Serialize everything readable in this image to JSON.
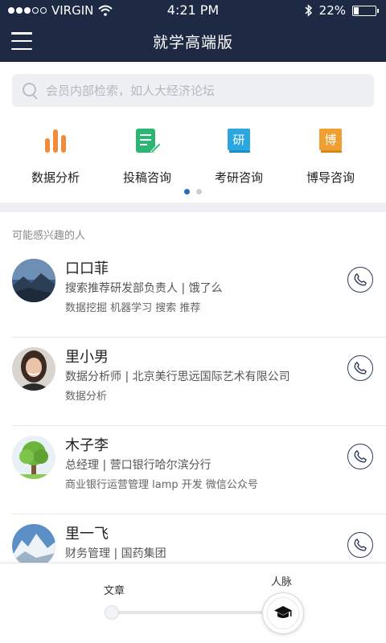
{
  "status_bar": {
    "carrier": "VIRGIN",
    "time": "4:21 PM",
    "battery": "22%",
    "battery_level": 0.22
  },
  "header": {
    "title": "就学高端版"
  },
  "search": {
    "placeholder": "会员内部检索，如人大经济论坛"
  },
  "categories": [
    {
      "label": "数据分析",
      "icon": "bar-chart-icon",
      "color": "#f08a3c"
    },
    {
      "label": "投稿咨询",
      "icon": "document-edit-icon",
      "color": "#2bb673"
    },
    {
      "label": "考研咨询",
      "icon": "book-yan-icon",
      "glyph": "研",
      "color": "#2aa7e0"
    },
    {
      "label": "博导咨询",
      "icon": "book-bo-icon",
      "glyph": "博",
      "color": "#f0a030"
    }
  ],
  "pager": {
    "pages": 2,
    "active": 1
  },
  "people_section": {
    "title": "可能感兴趣的人",
    "people": [
      {
        "name": "口口菲",
        "info": "搜索推荐研发部负责人 | 饿了么",
        "tags": "数据挖掘 机器学习 搜索 推荐"
      },
      {
        "name": "里小男",
        "info": "数据分析师 | 北京美行思远国际艺术有限公司",
        "tags": "数据分析"
      },
      {
        "name": "木子李",
        "info": "总经理  | 营口银行哈尔滨分行",
        "tags": "商业银行运营管理 lamp 开发 微信公众号"
      },
      {
        "name": "里一飞",
        "info": "财务管理 | 国药集团",
        "tags": ""
      }
    ]
  },
  "bottom_bar": {
    "left_label": "文章",
    "right_label": "人脉"
  },
  "colors": {
    "header_bg": "#1e2a44",
    "accent": "#2a6ab8"
  }
}
